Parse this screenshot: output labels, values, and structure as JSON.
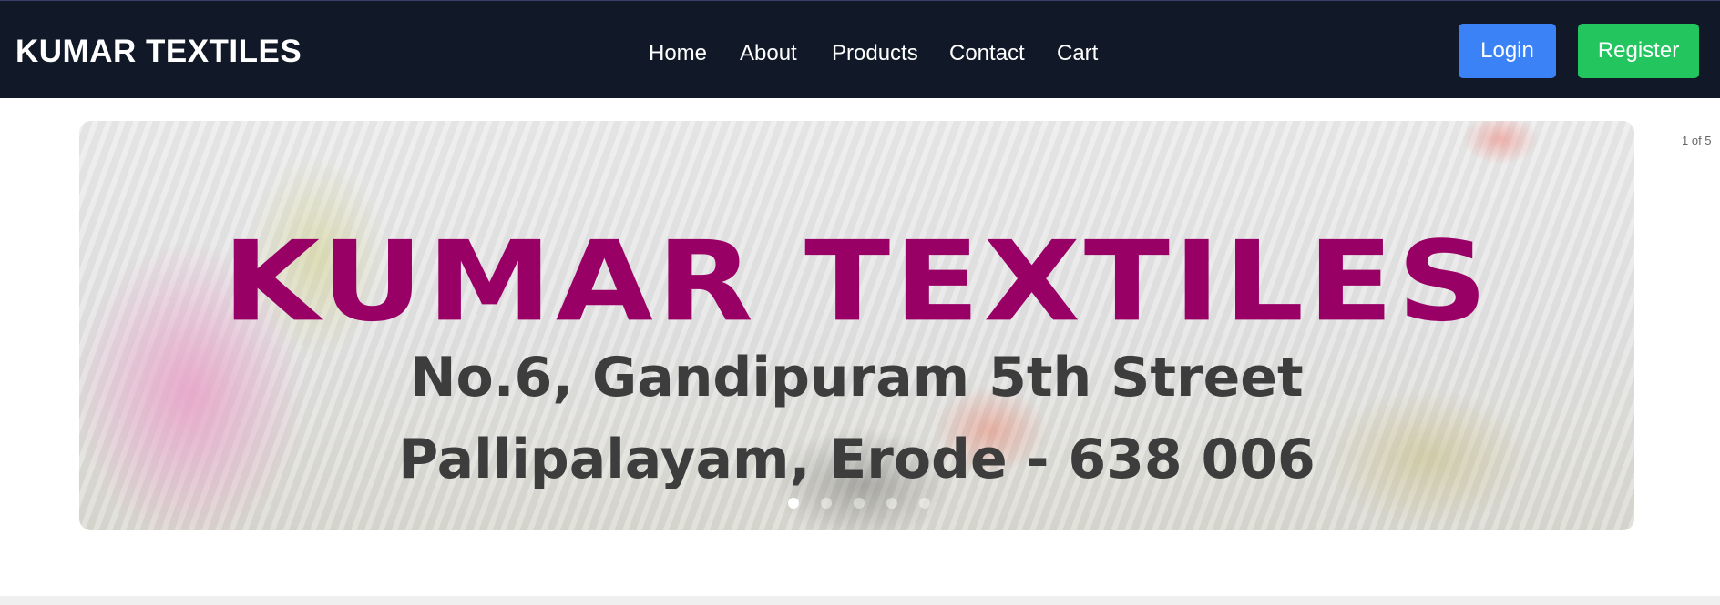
{
  "navbar": {
    "brand": "KUMAR TEXTILES",
    "links": [
      "Home",
      "About",
      "Products",
      "Contact",
      "Cart"
    ],
    "login_label": "Login",
    "register_label": "Register"
  },
  "carousel": {
    "slide_title": "KUMAR TEXTILES",
    "slide_line1": "No.6, Gandipuram 5th Street",
    "slide_line2": "Pallipalayam, Erode - 638 006",
    "counter": "1 of 5",
    "dot_count": 5,
    "active_index": 0
  },
  "colors": {
    "navbar_bg": "#111827",
    "login_bg": "#3b82f6",
    "register_bg": "#22c55e",
    "slide_title": "#990066"
  }
}
